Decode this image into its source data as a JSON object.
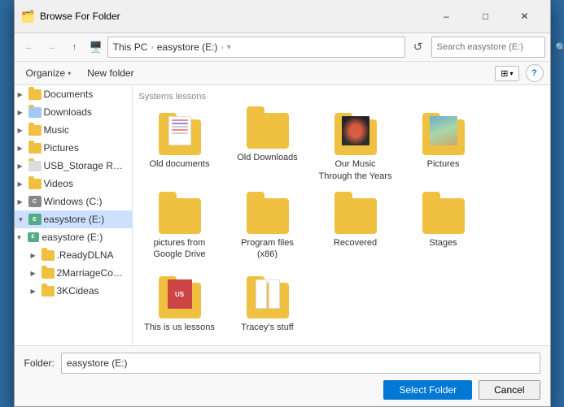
{
  "dialog": {
    "title": "Browse For Folder",
    "title_icon": "📁"
  },
  "address_bar": {
    "back_tooltip": "Back",
    "forward_tooltip": "Forward",
    "up_tooltip": "Up",
    "breadcrumb": [
      "This PC",
      "easystore (E:)"
    ],
    "breadcrumb_separator": "›",
    "refresh_tooltip": "Refresh",
    "search_placeholder": "Search easystore (E:)"
  },
  "toolbar": {
    "organize_label": "Organize",
    "new_folder_label": "New folder",
    "view_label": "⊞",
    "help_label": "?"
  },
  "sidebar": {
    "items": [
      {
        "id": "documents",
        "label": "Documents",
        "icon": "folder",
        "indent": 1,
        "expanded": false
      },
      {
        "id": "downloads",
        "label": "Downloads",
        "icon": "folder-down",
        "indent": 1,
        "expanded": false
      },
      {
        "id": "music",
        "label": "Music",
        "icon": "folder-music",
        "indent": 1,
        "expanded": false
      },
      {
        "id": "pictures",
        "label": "Pictures",
        "icon": "folder-pic",
        "indent": 1,
        "expanded": false
      },
      {
        "id": "usb-storage",
        "label": "USB_Storage Rea...",
        "icon": "folder",
        "indent": 1,
        "expanded": false
      },
      {
        "id": "videos",
        "label": "Videos",
        "icon": "folder-video",
        "indent": 1,
        "expanded": false
      },
      {
        "id": "windows-c",
        "label": "Windows (C:)",
        "icon": "drive-c",
        "indent": 1,
        "expanded": false
      },
      {
        "id": "easystore-e",
        "label": "easystore (E:)",
        "icon": "drive-e",
        "indent": 1,
        "expanded": true,
        "selected": true
      },
      {
        "id": "easystore-tree",
        "label": "easystore (E:)",
        "icon": "drive-e2",
        "indent": 0,
        "expanded": true
      },
      {
        "id": "readydlna",
        "label": ".ReadyDLNA",
        "icon": "folder",
        "indent": 2,
        "expanded": false
      },
      {
        "id": "2marriage",
        "label": "2MarriageConfe...",
        "icon": "folder",
        "indent": 2,
        "expanded": false
      },
      {
        "id": "3kcideas",
        "label": "3KCideas",
        "icon": "folder",
        "indent": 2,
        "expanded": false
      }
    ]
  },
  "files": [
    {
      "id": "old-documents",
      "label": "Old documents",
      "type": "folder-doc",
      "selected": false
    },
    {
      "id": "old-downloads",
      "label": "Old Downloads",
      "type": "folder-plain",
      "selected": false
    },
    {
      "id": "our-music",
      "label": "Our Music Through the Years",
      "type": "folder-image",
      "selected": false
    },
    {
      "id": "pictures",
      "label": "Pictures",
      "type": "folder-photo",
      "selected": false
    },
    {
      "id": "pictures-google",
      "label": "pictures from Google Drive",
      "type": "folder-plain",
      "selected": false
    },
    {
      "id": "program-files",
      "label": "Program files (x86)",
      "type": "folder-plain",
      "selected": false
    },
    {
      "id": "recovered",
      "label": "Recovered",
      "type": "folder-plain",
      "selected": false
    },
    {
      "id": "stages",
      "label": "Stages",
      "type": "folder-plain",
      "selected": false
    },
    {
      "id": "this-is-us",
      "label": "This is us lessons",
      "type": "folder-book",
      "selected": false
    },
    {
      "id": "traceys-stuff",
      "label": "Tracey's stuff",
      "type": "folder-pages",
      "selected": false
    }
  ],
  "bottom": {
    "folder_label": "Folder:",
    "folder_path": "easystore (E:)",
    "select_button": "Select Folder",
    "cancel_button": "Cancel"
  }
}
